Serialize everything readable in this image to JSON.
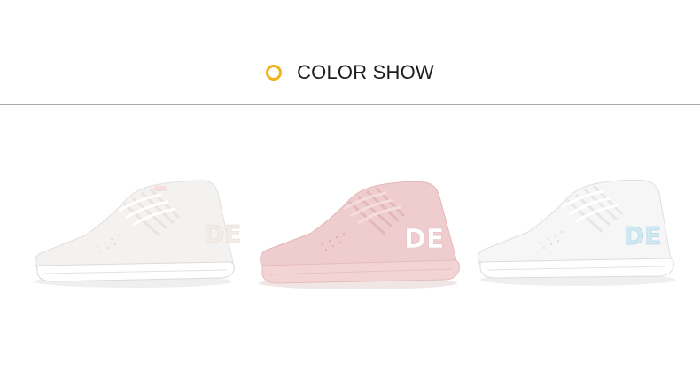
{
  "header": {
    "title": "COLOR SHOW",
    "ring_color": "#f0b21d"
  },
  "products": [
    {
      "name": "white-sneaker",
      "logo_text": "DE",
      "upper_color": "#f4f2f0",
      "logo_color": "#f2ece4",
      "sole_color": "#ffffff"
    },
    {
      "name": "pink-sneaker",
      "logo_text": "DE",
      "upper_color": "#efcdcf",
      "logo_color": "#ffffff",
      "sole_color": "#f3d4d4"
    },
    {
      "name": "white-blue-sneaker",
      "logo_text": "DE",
      "upper_color": "#f6f6f7",
      "logo_color": "#cfe8f1",
      "sole_color": "#ffffff"
    }
  ]
}
